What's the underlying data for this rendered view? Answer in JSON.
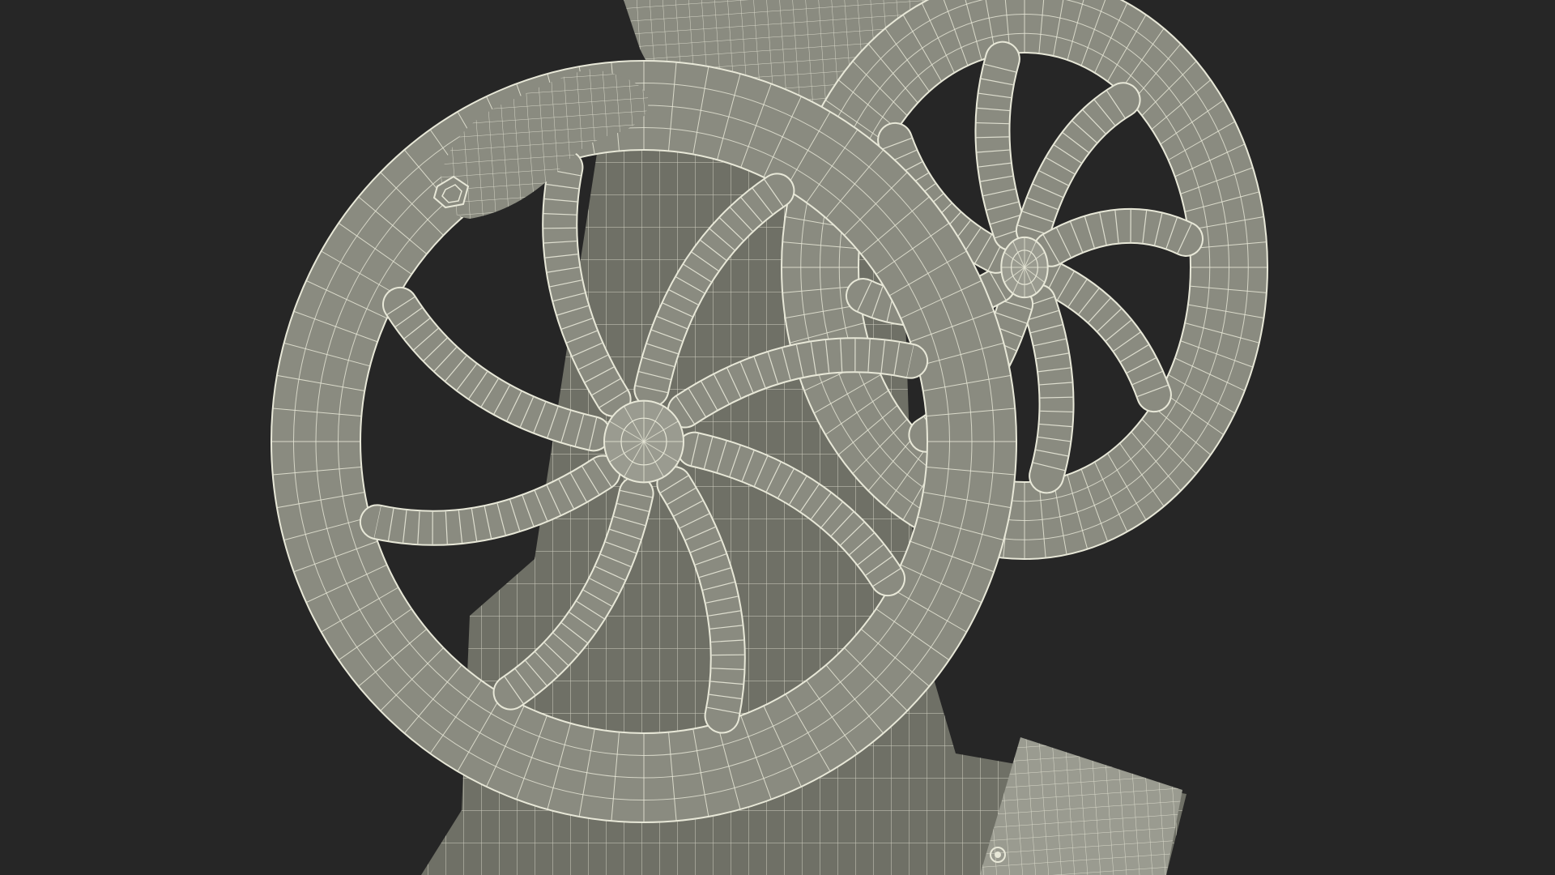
{
  "scene": {
    "background_color": "#262626",
    "model_fill": "#8a8b80",
    "model_fill_dark": "#6f7066",
    "model_fill_light": "#9a9b90",
    "wire_color": "#e8e8d8",
    "front_wheel_spokes": 8,
    "back_wheel_spokes": 8
  }
}
